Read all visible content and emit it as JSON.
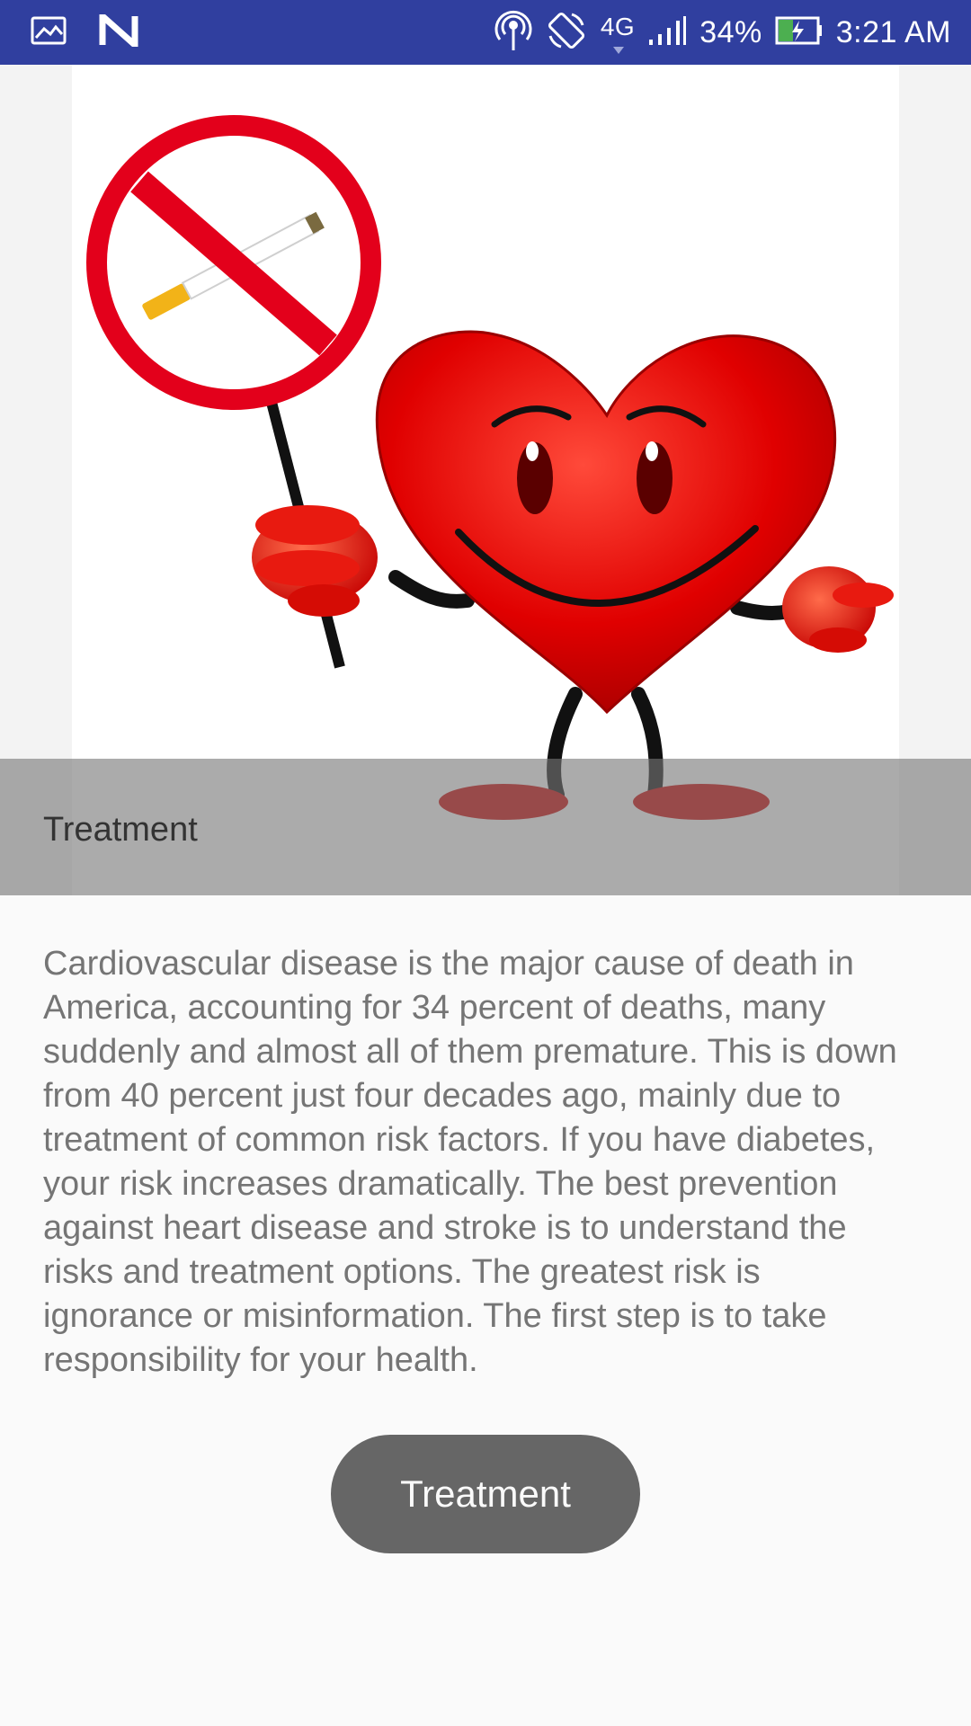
{
  "status_bar": {
    "network": "4G",
    "battery_percent": "34%",
    "time": "3:21 AM",
    "icons": [
      "gallery-icon",
      "n-app-icon",
      "hotspot-icon",
      "rotate-icon",
      "signal-icon",
      "battery-charging-icon"
    ]
  },
  "hero": {
    "image": "heart-mascot-holding-no-smoking-sign",
    "caption": "Treatment"
  },
  "content": {
    "description": "Cardiovascular disease is the major cause of death in America, accounting for 34 percent of deaths, many suddenly and almost all of them premature. This is down from 40 percent just four decades ago, mainly due to treatment of common risk factors. If you have diabetes, your risk increases dramatically. The best prevention against heart disease and stroke is to understand the risks and treatment options. The greatest risk is ignorance or misinformation. The first step is to take responsibility for your health."
  },
  "button": {
    "label": "Treatment"
  },
  "colors": {
    "status_bar": "#303f9f",
    "button": "#666666",
    "heart": "#e00000",
    "caption_band": "#8a8a8a"
  }
}
